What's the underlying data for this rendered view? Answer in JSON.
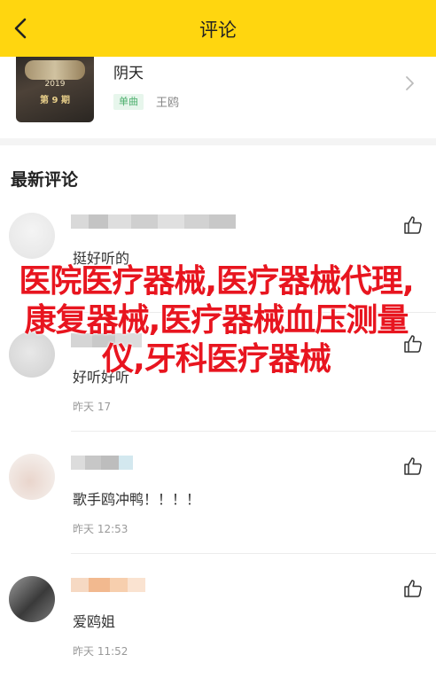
{
  "header": {
    "title": "评论",
    "back_icon": "back-arrow-icon",
    "background": "#ffd60f"
  },
  "album": {
    "cover_year": "2019",
    "cover_episode": "第 9 期",
    "name": "阴天",
    "tag": "单曲",
    "artist": "王鸥",
    "chevron_icon": "chevron-right-icon"
  },
  "section": {
    "title": "最新评论"
  },
  "comments": [
    {
      "text": "挺好听的",
      "time": ""
    },
    {
      "text": "好听好听",
      "time": "昨天 17"
    },
    {
      "text": "歌手鸥冲鸭！！！！",
      "time": "昨天 12:53"
    },
    {
      "text": "爱鸥姐",
      "time": "昨天 11:52"
    }
  ],
  "overlay": {
    "text": "医院医疗器械,医疗器械代理,康复器械,医疗器械血压测量仪,牙科医疗器械",
    "color": "#e8151f"
  },
  "icons": {
    "like": "thumbs-up-icon"
  }
}
